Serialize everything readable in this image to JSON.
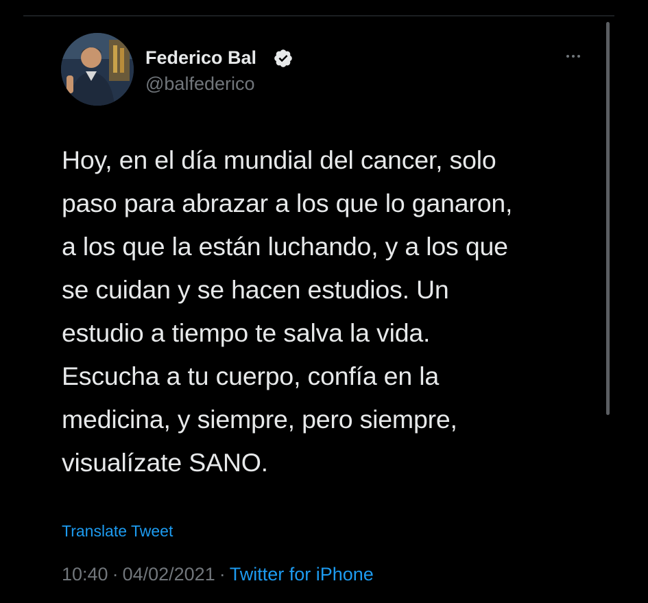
{
  "tweet": {
    "author": {
      "name": "Federico Bal",
      "handle": "@balfederico",
      "verified": true
    },
    "text": "Hoy, en el día mundial del cancer, solo\npaso para abrazar a los que lo ganaron,\na los que la están luchando, y a los que\nse cuidan y se hacen estudios. Un\nestudio a tiempo te salva la vida.\nEscucha a tu cuerpo, confía en la\nmedicina, y siempre, pero siempre,\nvisualízate SANO.",
    "translate_label": "Translate Tweet",
    "time": "10:40",
    "date": "04/02/2021",
    "separator": "·",
    "source": "Twitter for iPhone"
  },
  "icons": {
    "more": "more-horizontal-icon",
    "verified": "verified-badge-icon"
  },
  "colors": {
    "background": "#000000",
    "text_primary": "#e7e9ea",
    "text_secondary": "#71767b",
    "link": "#1d9bf0"
  }
}
